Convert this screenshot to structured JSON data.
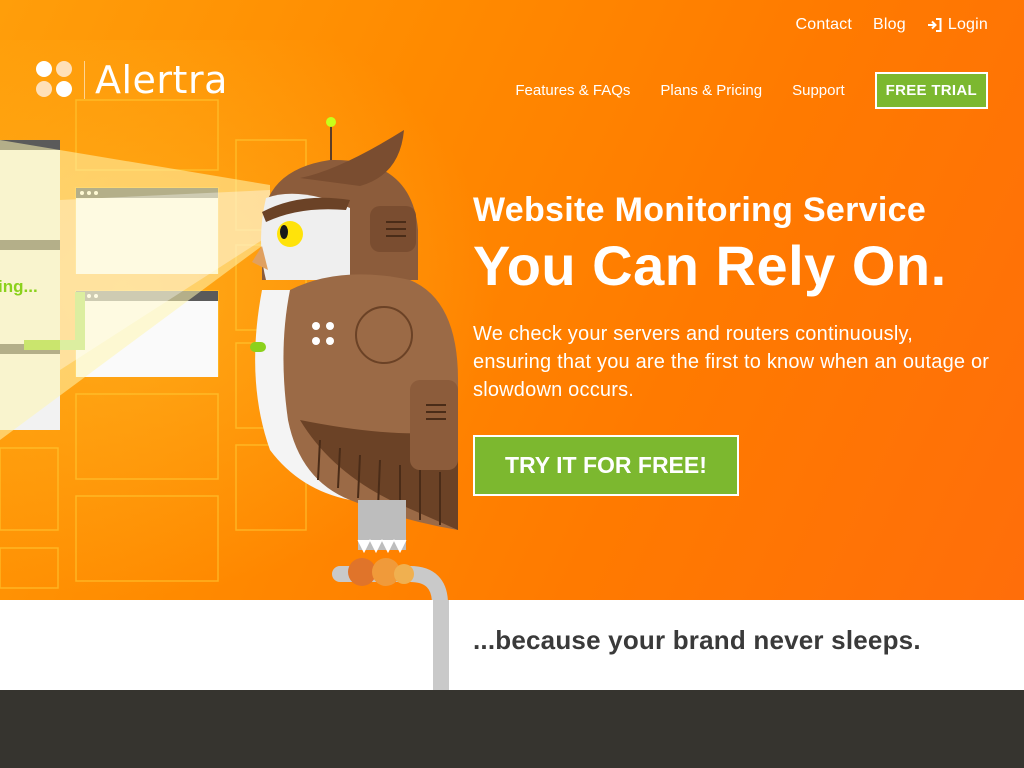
{
  "brand": {
    "name": "Alertra",
    "logo_colors": [
      "#ffffff",
      "#ffffff",
      "#ffd9a8",
      "#ffffff"
    ]
  },
  "topnav": {
    "contact": "Contact",
    "blog": "Blog",
    "login": "Login",
    "login_icon": "login-icon"
  },
  "mainnav": {
    "features": "Features & FAQs",
    "pricing": "Plans & Pricing",
    "support": "Support",
    "free_trial": "FREE TRIAL"
  },
  "hero": {
    "headline": "Website Monitoring Service",
    "subheadline": "You Can Rely On.",
    "description": "We check your servers and routers continuously, ensuring that you are the first to know when an outage or slowdown occurs.",
    "cta": "TRY IT FOR FREE!",
    "screen_text": "ing..."
  },
  "tagline": "...because your brand never sleeps.",
  "colors": {
    "orange": "#ff8400",
    "green": "#7cb82f",
    "dark": "#36342f",
    "owl_brown": "#9b6a46"
  }
}
